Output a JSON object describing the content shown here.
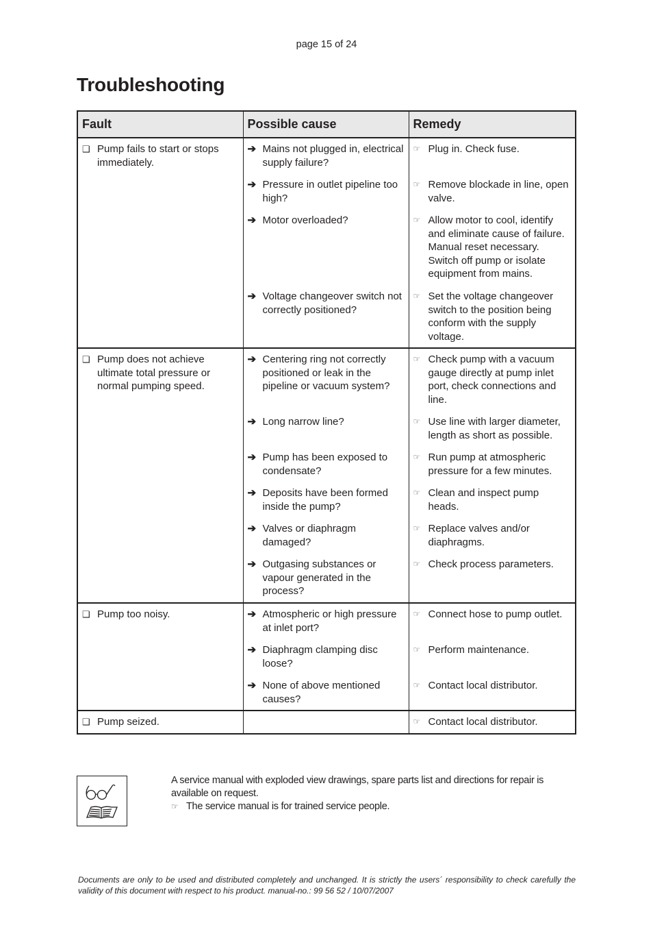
{
  "header": {
    "page_label": "page 15 of 24"
  },
  "title": "Troubleshooting",
  "table": {
    "columns": [
      "Fault",
      "Possible cause",
      "Remedy"
    ],
    "rows": [
      {
        "fault": "Pump fails to start or stops immediately.",
        "items": [
          {
            "cause": "Mains not plugged in, electrical supply failure?",
            "remedy": "Plug in. Check fuse."
          },
          {
            "cause": "Pressure in outlet pipeline too high?",
            "remedy": "Remove blockade in line, open valve."
          },
          {
            "cause": "Motor overloaded?",
            "remedy": "Allow  motor to cool, identify and eliminate cause of failure. Manual reset necessary. Switch off pump or isolate equipment from mains."
          },
          {
            "cause": "Voltage changeover switch not correctly positioned?",
            "remedy": "Set the voltage changeover switch to the position being conform with the supply voltage."
          }
        ]
      },
      {
        "fault": "Pump does not achieve ultimate total pressure or normal pumping speed.",
        "items": [
          {
            "cause": "Centering ring not correctly positioned or leak in the pipeline or vacuum system?",
            "remedy": "Check pump with a vacuum gauge directly at pump inlet port, check connections and line."
          },
          {
            "cause": "Long narrow line?",
            "remedy": "Use line with larger diameter, length as short as possible."
          },
          {
            "cause": "Pump has been exposed to condensate?",
            "remedy": "Run pump at atmospheric pressure for a few minutes."
          },
          {
            "cause": "Deposits have been formed inside the pump?",
            "remedy": "Clean and inspect pump heads."
          },
          {
            "cause": "Valves or diaphragm damaged?",
            "remedy": "Replace valves and/or diaphragms."
          },
          {
            "cause": "Outgasing substances or vapour generated in the process?",
            "remedy": "Check process parameters."
          }
        ]
      },
      {
        "fault": "Pump too noisy.",
        "items": [
          {
            "cause": "Atmospheric or high pressure at inlet port?",
            "remedy": "Connect hose to pump outlet."
          },
          {
            "cause": "Diaphragm clamping disc loose?",
            "remedy": "Perform maintenance."
          },
          {
            "cause": "None of above mentioned causes?",
            "remedy": "Contact local distributor."
          }
        ]
      },
      {
        "fault": "Pump seized.",
        "items": [
          {
            "cause": "",
            "remedy": "Contact local distributor."
          }
        ]
      }
    ]
  },
  "icons": {
    "fault_bullet": "checkbox-icon",
    "cause_bullet": "arrow-right-icon",
    "remedy_bullet": "pointing-hand-icon",
    "service_icon": "glasses-and-book-icon"
  },
  "service": {
    "text": "A service manual with exploded view drawings, spare parts list and directions for repair is available on request.",
    "note": "The service manual is for trained service people."
  },
  "disclaimer": "Documents are only to be used and distributed completely and unchanged. It is strictly the users´ responsibility to check carefully the validity of this document with respect to his product. manual-no.: 99 56 52  / 10/07/2007"
}
